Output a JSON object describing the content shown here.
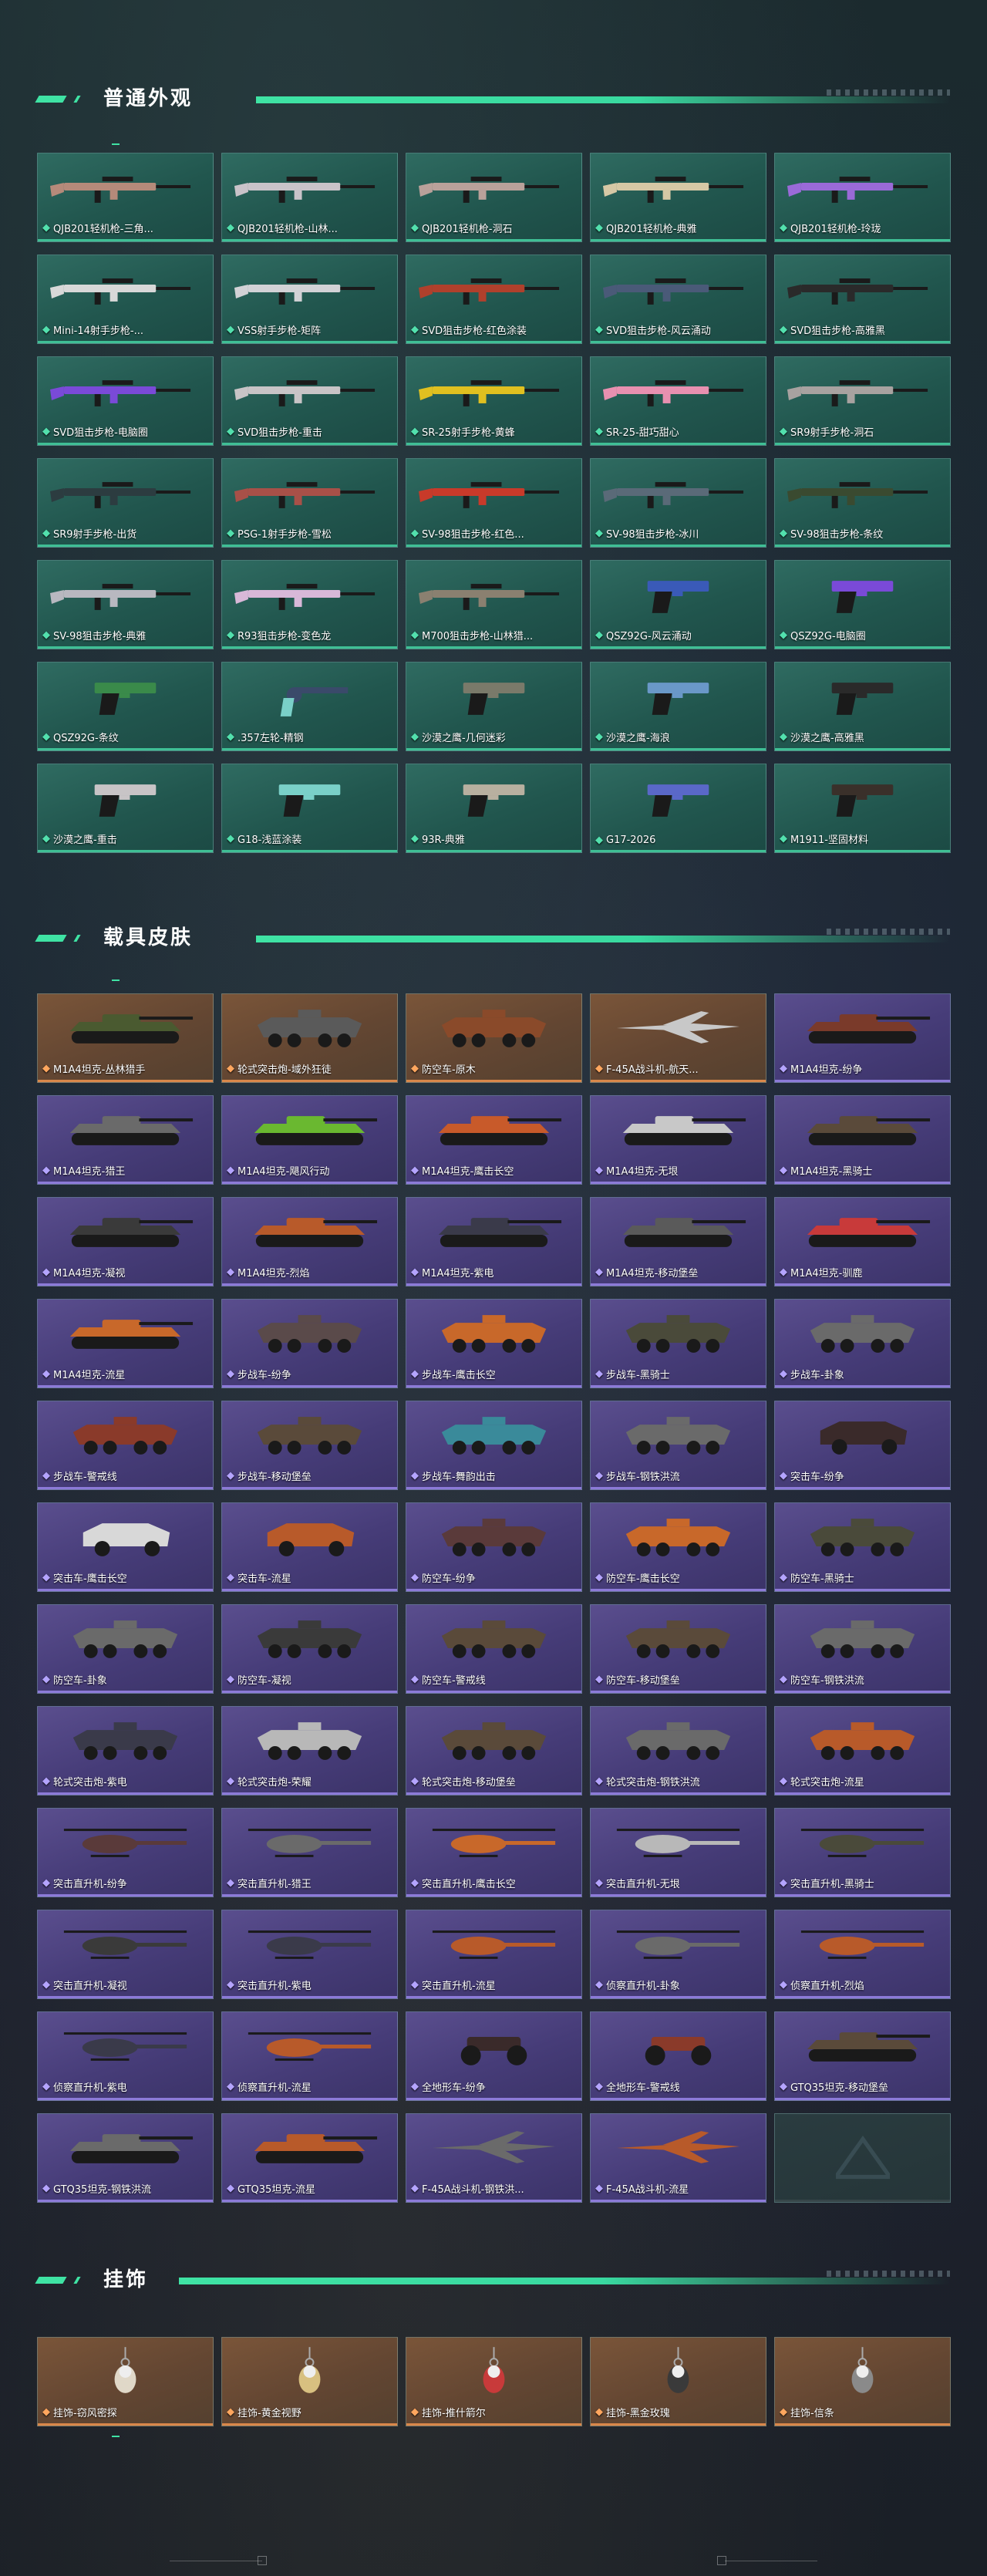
{
  "sections": {
    "weapons": {
      "title": "普通外观"
    },
    "vehicles": {
      "title": "载具皮肤"
    },
    "charms": {
      "title": "挂饰"
    }
  },
  "colors": {
    "accent": "#3fe3a4",
    "rarity_green": "#52e0ad",
    "rarity_purple": "#b4a4ff",
    "rarity_orange": "#ffa65e"
  },
  "weapons": [
    {
      "name": "QJB201轻机枪-三角...",
      "rarity": "green",
      "icon": "rifle-icon",
      "color": "#b58a7a"
    },
    {
      "name": "QJB201轻机枪-山林...",
      "rarity": "green",
      "icon": "rifle-icon",
      "color": "#c9c3c9"
    },
    {
      "name": "QJB201轻机枪-洞石",
      "rarity": "green",
      "icon": "rifle-icon",
      "color": "#b9a19a"
    },
    {
      "name": "QJB201轻机枪-典雅",
      "rarity": "green",
      "icon": "rifle-icon",
      "color": "#d6c8a5"
    },
    {
      "name": "QJB201轻机枪-玲珑",
      "rarity": "green",
      "icon": "rifle-icon",
      "color": "#9a6ad8"
    },
    {
      "name": "Mini-14射手步枪-...",
      "rarity": "green",
      "icon": "rifle-icon",
      "color": "#d8d8d8"
    },
    {
      "name": "VSS射手步枪-矩阵",
      "rarity": "green",
      "icon": "rifle-icon",
      "color": "#d2d2d6"
    },
    {
      "name": "SVD狙击步枪-红色涂装",
      "rarity": "green",
      "icon": "rifle-icon",
      "color": "#b0402c"
    },
    {
      "name": "SVD狙击步枪-风云涌动",
      "rarity": "green",
      "icon": "rifle-icon",
      "color": "#4a5a78"
    },
    {
      "name": "SVD狙击步枪-高雅黑",
      "rarity": "green",
      "icon": "rifle-icon",
      "color": "#2a2a2a"
    },
    {
      "name": "SVD狙击步枪-电脑圈",
      "rarity": "green",
      "icon": "rifle-icon",
      "color": "#7a4ad8"
    },
    {
      "name": "SVD狙击步枪-重击",
      "rarity": "green",
      "icon": "rifle-icon",
      "color": "#c8c4c6"
    },
    {
      "name": "SR-25射手步枪-黄蜂",
      "rarity": "green",
      "icon": "rifle-icon",
      "color": "#e0c020"
    },
    {
      "name": "SR-25-甜巧甜心",
      "rarity": "green",
      "icon": "rifle-icon",
      "color": "#e890b0"
    },
    {
      "name": "SR9射手步枪-洞石",
      "rarity": "green",
      "icon": "rifle-icon",
      "color": "#a8a2a0"
    },
    {
      "name": "SR9射手步枪-出货",
      "rarity": "green",
      "icon": "rifle-icon",
      "color": "#2c3c40"
    },
    {
      "name": "PSG-1射手步枪-雪松",
      "rarity": "green",
      "icon": "rifle-icon",
      "color": "#a85048"
    },
    {
      "name": "SV-98狙击步枪-红色...",
      "rarity": "green",
      "icon": "rifle-icon",
      "color": "#c83a2a"
    },
    {
      "name": "SV-98狙击步枪-冰川",
      "rarity": "green",
      "icon": "rifle-icon",
      "color": "#5a6a78"
    },
    {
      "name": "SV-98狙击步枪-条纹",
      "rarity": "green",
      "icon": "rifle-icon",
      "color": "#3a4a30"
    },
    {
      "name": "SV-98狙击步枪-典雅",
      "rarity": "green",
      "icon": "rifle-icon",
      "color": "#b8b8c0"
    },
    {
      "name": "R93狙击步枪-变色龙",
      "rarity": "green",
      "icon": "rifle-icon",
      "color": "#d8b8d8"
    },
    {
      "name": "M700狙击步枪-山林猎...",
      "rarity": "green",
      "icon": "rifle-icon",
      "color": "#8a8070"
    },
    {
      "name": "QSZ92G-风云涌动",
      "rarity": "green",
      "icon": "pistol-icon",
      "color": "#3a5ab8"
    },
    {
      "name": "QSZ92G-电脑圈",
      "rarity": "green",
      "icon": "pistol-icon",
      "color": "#7a4ad8"
    },
    {
      "name": "QSZ92G-条纹",
      "rarity": "green",
      "icon": "pistol-icon",
      "color": "#3a8a4a"
    },
    {
      "name": ".357左轮-精钢",
      "rarity": "green",
      "icon": "revolver-icon",
      "color": "#3a4a6a"
    },
    {
      "name": "沙漠之鹰-几何迷彩",
      "rarity": "green",
      "icon": "pistol-icon",
      "color": "#7a7a6a"
    },
    {
      "name": "沙漠之鹰-海浪",
      "rarity": "green",
      "icon": "pistol-icon",
      "color": "#6a98c8"
    },
    {
      "name": "沙漠之鹰-高雅黑",
      "rarity": "green",
      "icon": "pistol-icon",
      "color": "#2a2a2a"
    },
    {
      "name": "沙漠之鹰-重击",
      "rarity": "green",
      "icon": "pistol-icon",
      "color": "#c8c4c6"
    },
    {
      "name": "G18-浅蓝涂装",
      "rarity": "green",
      "icon": "pistol-icon",
      "color": "#7ad0c8"
    },
    {
      "name": "93R-典雅",
      "rarity": "green",
      "icon": "pistol-icon",
      "color": "#b8b0a0"
    },
    {
      "name": "G17-2026",
      "rarity": "green",
      "icon": "pistol-icon",
      "color": "#5a68c8"
    },
    {
      "name": "M1911-坚固材料",
      "rarity": "green",
      "icon": "pistol-icon",
      "color": "#3a302a"
    }
  ],
  "vehicles": [
    {
      "name": "M1A4坦克-丛林猎手",
      "rarity": "orange",
      "icon": "tank-icon",
      "color": "#4a5a30"
    },
    {
      "name": "轮式突击炮-域外狂徒",
      "rarity": "orange",
      "icon": "apc-icon",
      "color": "#5a5a5a"
    },
    {
      "name": "防空车-原木",
      "rarity": "orange",
      "icon": "apc-icon",
      "color": "#8a4a2a"
    },
    {
      "name": "F-45A战斗机-航天...",
      "rarity": "orange",
      "icon": "jet-icon",
      "color": "#c8c8c8"
    },
    {
      "name": "M1A4坦克-纷争",
      "rarity": "purple",
      "icon": "tank-icon",
      "color": "#7a3a2a"
    },
    {
      "name": "M1A4坦克-猎王",
      "rarity": "purple",
      "icon": "tank-icon",
      "color": "#6a6a6a"
    },
    {
      "name": "M1A4坦克-飓风行动",
      "rarity": "purple",
      "icon": "tank-icon",
      "color": "#6ab830"
    },
    {
      "name": "M1A4坦克-鹰击长空",
      "rarity": "purple",
      "icon": "tank-icon",
      "color": "#c85a2a"
    },
    {
      "name": "M1A4坦克-无垠",
      "rarity": "purple",
      "icon": "tank-icon",
      "color": "#c8c8c8"
    },
    {
      "name": "M1A4坦克-黑骑士",
      "rarity": "purple",
      "icon": "tank-icon",
      "color": "#5a4a3a"
    },
    {
      "name": "M1A4坦克-凝视",
      "rarity": "purple",
      "icon": "tank-icon",
      "color": "#3a3a3a"
    },
    {
      "name": "M1A4坦克-烈焰",
      "rarity": "purple",
      "icon": "tank-icon",
      "color": "#b85a2a"
    },
    {
      "name": "M1A4坦克-紫电",
      "rarity": "purple",
      "icon": "tank-icon",
      "color": "#3a3a4a"
    },
    {
      "name": "M1A4坦克-移动堡垒",
      "rarity": "purple",
      "icon": "tank-icon",
      "color": "#5a5a5a"
    },
    {
      "name": "M1A4坦克-驯鹿",
      "rarity": "purple",
      "icon": "tank-icon",
      "color": "#c83a3a"
    },
    {
      "name": "M1A4坦克-流星",
      "rarity": "purple",
      "icon": "tank-icon",
      "color": "#c8682a"
    },
    {
      "name": "步战车-纷争",
      "rarity": "purple",
      "icon": "apc-icon",
      "color": "#5a4a4a"
    },
    {
      "name": "步战车-鹰击长空",
      "rarity": "purple",
      "icon": "apc-icon",
      "color": "#c8682a"
    },
    {
      "name": "步战车-黑骑士",
      "rarity": "purple",
      "icon": "apc-icon",
      "color": "#4a4a3a"
    },
    {
      "name": "步战车-卦象",
      "rarity": "purple",
      "icon": "apc-icon",
      "color": "#6a6a6a"
    },
    {
      "name": "步战车-警戒线",
      "rarity": "purple",
      "icon": "apc-icon",
      "color": "#8a3a2a"
    },
    {
      "name": "步战车-移动堡垒",
      "rarity": "purple",
      "icon": "apc-icon",
      "color": "#5a4a3a"
    },
    {
      "name": "步战车-舞韵出击",
      "rarity": "purple",
      "icon": "apc-icon",
      "color": "#3a8a9a"
    },
    {
      "name": "步战车-钢铁洪流",
      "rarity": "purple",
      "icon": "apc-icon",
      "color": "#6a6a6a"
    },
    {
      "name": "突击车-纷争",
      "rarity": "purple",
      "icon": "truck-icon",
      "color": "#3a2a2a"
    },
    {
      "name": "突击车-鹰击长空",
      "rarity": "purple",
      "icon": "truck-icon",
      "color": "#d8d8d8"
    },
    {
      "name": "突击车-流星",
      "rarity": "purple",
      "icon": "truck-icon",
      "color": "#b85a2a"
    },
    {
      "name": "防空车-纷争",
      "rarity": "purple",
      "icon": "apc-icon",
      "color": "#5a3a3a"
    },
    {
      "name": "防空车-鹰击长空",
      "rarity": "purple",
      "icon": "apc-icon",
      "color": "#c8682a"
    },
    {
      "name": "防空车-黑骑士",
      "rarity": "purple",
      "icon": "apc-icon",
      "color": "#4a4a3a"
    },
    {
      "name": "防空车-卦象",
      "rarity": "purple",
      "icon": "apc-icon",
      "color": "#6a6a6a"
    },
    {
      "name": "防空车-凝视",
      "rarity": "purple",
      "icon": "apc-icon",
      "color": "#3a3a3a"
    },
    {
      "name": "防空车-警戒线",
      "rarity": "purple",
      "icon": "apc-icon",
      "color": "#5a4a3a"
    },
    {
      "name": "防空车-移动堡垒",
      "rarity": "purple",
      "icon": "apc-icon",
      "color": "#5a4a3a"
    },
    {
      "name": "防空车-钢铁洪流",
      "rarity": "purple",
      "icon": "apc-icon",
      "color": "#6a6a6a"
    },
    {
      "name": "轮式突击炮-紫电",
      "rarity": "purple",
      "icon": "apc-icon",
      "color": "#3a3a4a"
    },
    {
      "name": "轮式突击炮-荣耀",
      "rarity": "purple",
      "icon": "apc-icon",
      "color": "#b8b8b8"
    },
    {
      "name": "轮式突击炮-移动堡垒",
      "rarity": "purple",
      "icon": "apc-icon",
      "color": "#5a4a3a"
    },
    {
      "name": "轮式突击炮-钢铁洪流",
      "rarity": "purple",
      "icon": "apc-icon",
      "color": "#6a6a6a"
    },
    {
      "name": "轮式突击炮-流星",
      "rarity": "purple",
      "icon": "apc-icon",
      "color": "#b85a2a"
    },
    {
      "name": "突击直升机-纷争",
      "rarity": "purple",
      "icon": "helicopter-icon",
      "color": "#5a3a3a"
    },
    {
      "name": "突击直升机-猎王",
      "rarity": "purple",
      "icon": "helicopter-icon",
      "color": "#6a6a6a"
    },
    {
      "name": "突击直升机-鹰击长空",
      "rarity": "purple",
      "icon": "helicopter-icon",
      "color": "#c8682a"
    },
    {
      "name": "突击直升机-无垠",
      "rarity": "purple",
      "icon": "helicopter-icon",
      "color": "#b8b8b8"
    },
    {
      "name": "突击直升机-黑骑士",
      "rarity": "purple",
      "icon": "helicopter-icon",
      "color": "#4a4a3a"
    },
    {
      "name": "突击直升机-凝视",
      "rarity": "purple",
      "icon": "helicopter-icon",
      "color": "#3a3a3a"
    },
    {
      "name": "突击直升机-紫电",
      "rarity": "purple",
      "icon": "helicopter-icon",
      "color": "#3a3a4a"
    },
    {
      "name": "突击直升机-流星",
      "rarity": "purple",
      "icon": "helicopter-icon",
      "color": "#b85a2a"
    },
    {
      "name": "侦察直升机-卦象",
      "rarity": "purple",
      "icon": "helicopter-icon",
      "color": "#6a6a6a"
    },
    {
      "name": "侦察直升机-烈焰",
      "rarity": "purple",
      "icon": "helicopter-icon",
      "color": "#b85a2a"
    },
    {
      "name": "侦察直升机-紫电",
      "rarity": "purple",
      "icon": "helicopter-icon",
      "color": "#3a3a4a"
    },
    {
      "name": "侦察直升机-流星",
      "rarity": "purple",
      "icon": "helicopter-icon",
      "color": "#b85a2a"
    },
    {
      "name": "全地形车-纷争",
      "rarity": "purple",
      "icon": "atv-icon",
      "color": "#3a2a2a"
    },
    {
      "name": "全地形车-警戒线",
      "rarity": "purple",
      "icon": "atv-icon",
      "color": "#8a3a2a"
    },
    {
      "name": "GTQ35坦克-移动堡垒",
      "rarity": "purple",
      "icon": "tank-icon",
      "color": "#5a4a3a"
    },
    {
      "name": "GTQ35坦克-钢铁洪流",
      "rarity": "purple",
      "icon": "tank-icon",
      "color": "#6a6a6a"
    },
    {
      "name": "GTQ35坦克-流星",
      "rarity": "purple",
      "icon": "tank-icon",
      "color": "#b85a2a"
    },
    {
      "name": "F-45A战斗机-钢铁洪...",
      "rarity": "purple",
      "icon": "jet-icon",
      "color": "#6a6a6a"
    },
    {
      "name": "F-45A战斗机-流星",
      "rarity": "purple",
      "icon": "jet-icon",
      "color": "#b85a2a"
    },
    {
      "name": "",
      "rarity": "empty",
      "icon": "logo-icon",
      "color": ""
    }
  ],
  "charms": [
    {
      "name": "挂饰-窃风密探",
      "rarity": "orange",
      "icon": "figure-charm-icon",
      "color": "#e0d8c8"
    },
    {
      "name": "挂饰-黄金视野",
      "rarity": "orange",
      "icon": "figure-charm-icon",
      "color": "#d8c080"
    },
    {
      "name": "挂饰-推什箭尔",
      "rarity": "orange",
      "icon": "bottle-charm-icon",
      "color": "#c83a3a"
    },
    {
      "name": "挂饰-黑金玫瑰",
      "rarity": "orange",
      "icon": "rose-charm-icon",
      "color": "#3a3a3a"
    },
    {
      "name": "挂饰-信条",
      "rarity": "orange",
      "icon": "tag-charm-icon",
      "color": "#8a8a8a"
    }
  ]
}
